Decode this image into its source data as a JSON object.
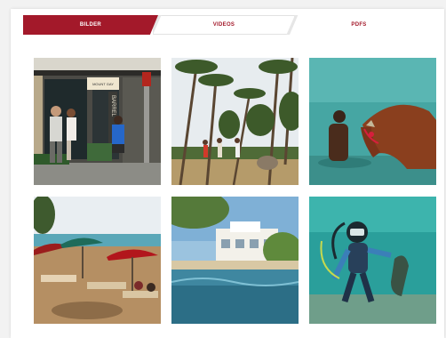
{
  "tabs": [
    {
      "label": "BILDER",
      "active": true
    },
    {
      "label": "VIDEOS",
      "active": false
    },
    {
      "label": "PDFS",
      "active": false
    }
  ],
  "photos": [
    {
      "subject": "street-cafe-storefront",
      "sign": "MOUNT GAY",
      "vertical_sign": "BARREL"
    },
    {
      "subject": "palm-beach-walkers"
    },
    {
      "subject": "man-with-horse-in-sea"
    },
    {
      "subject": "beach-umbrellas-loungers"
    },
    {
      "subject": "beachfront-villa"
    },
    {
      "subject": "diver-underwater"
    }
  ],
  "colors": {
    "accent": "#a3192a",
    "panel": "#ffffff",
    "page": "#f2f2f2"
  }
}
